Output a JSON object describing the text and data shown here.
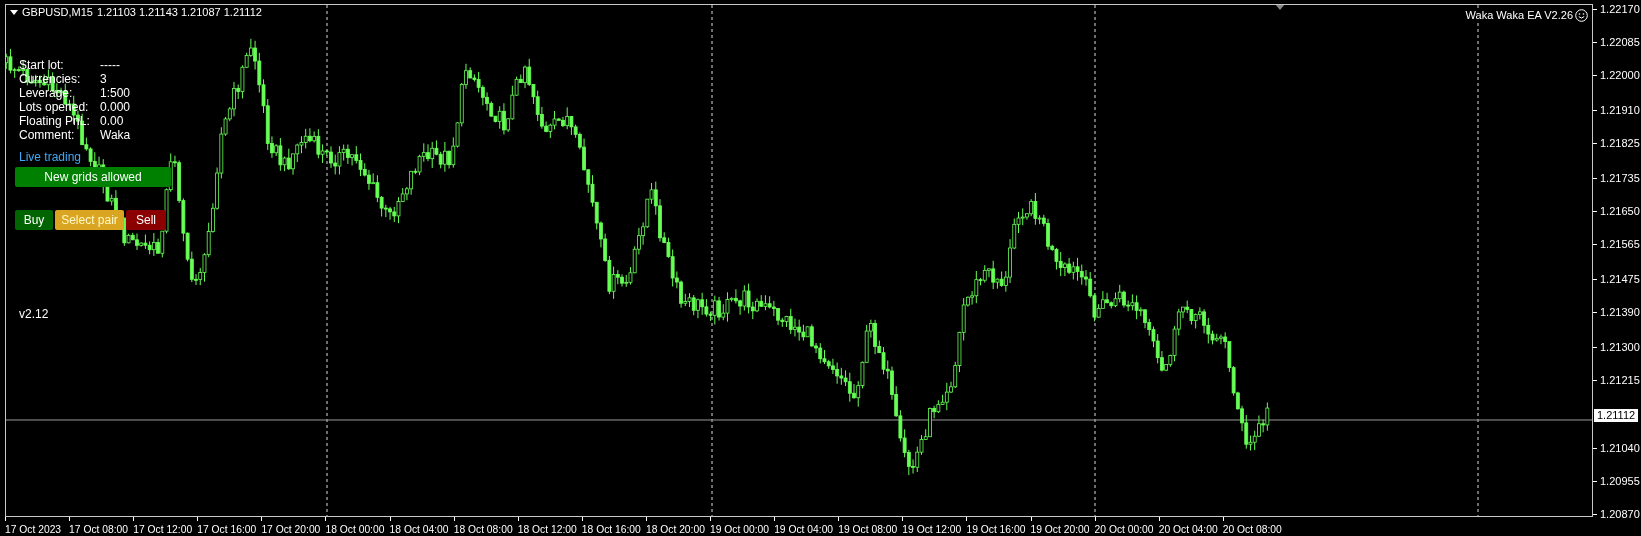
{
  "chart_header": {
    "symbol": "GBPUSD,M15",
    "quotes": "1.21103 1.21143 1.21087 1.21112"
  },
  "ea_label": {
    "name": "Waka Waka EA  V2.26"
  },
  "info_panel": [
    {
      "label": "Start lot:",
      "value": "-----"
    },
    {
      "label": "Currencies:",
      "value": "3"
    },
    {
      "label": "Leverage:",
      "value": "1:500"
    },
    {
      "label": "Lots opened:",
      "value": "0.000"
    },
    {
      "label": "Floating PnL:",
      "value": "0.00"
    },
    {
      "label": "Comment:",
      "value": "Waka"
    }
  ],
  "mode": "Live trading",
  "grid_button": {
    "label": "New grids allowed",
    "color": "#008000"
  },
  "buttons": [
    {
      "label": "Buy",
      "color": "#006400"
    },
    {
      "label": "Select pair",
      "color": "#daa520"
    },
    {
      "label": "Sell",
      "color": "#8b0000"
    }
  ],
  "version": "v2.12",
  "price_axis": [
    "1.22170",
    "1.22085",
    "1.22000",
    "1.21910",
    "1.21825",
    "1.21735",
    "1.21650",
    "1.21565",
    "1.21475",
    "1.21390",
    "1.21300",
    "1.21215",
    "1.21040",
    "1.20955",
    "1.20870"
  ],
  "current_price": "1.21112",
  "time_axis": [
    "17 Oct 2023",
    "17 Oct 08:00",
    "17 Oct 12:00",
    "17 Oct 16:00",
    "17 Oct 20:00",
    "18 Oct 00:00",
    "18 Oct 04:00",
    "18 Oct 08:00",
    "18 Oct 12:00",
    "18 Oct 16:00",
    "18 Oct 20:00",
    "19 Oct 00:00",
    "19 Oct 04:00",
    "19 Oct 08:00",
    "19 Oct 12:00",
    "19 Oct 16:00",
    "19 Oct 20:00",
    "20 Oct 00:00",
    "20 Oct 04:00",
    "20 Oct 08:00"
  ]
}
